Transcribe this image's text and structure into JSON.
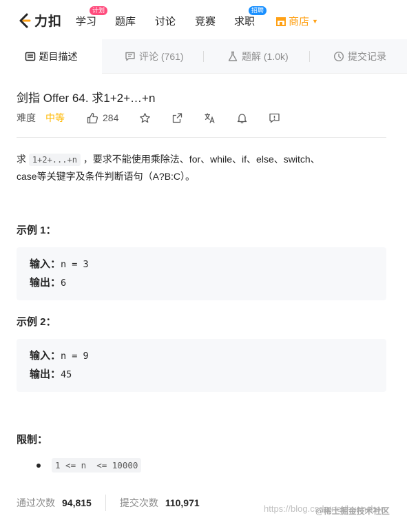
{
  "nav": {
    "logo_text": "力扣",
    "items": [
      {
        "label": "学习",
        "badge": "计划"
      },
      {
        "label": "题库"
      },
      {
        "label": "讨论"
      },
      {
        "label": "竞赛"
      },
      {
        "label": "求职",
        "badge": "招聘"
      },
      {
        "label": "商店"
      }
    ]
  },
  "tabs": [
    {
      "label": "题目描述",
      "icon": "description-icon",
      "active": true
    },
    {
      "label": "评论 (761)",
      "icon": "comment-icon"
    },
    {
      "label": "题解 (1.0k)",
      "icon": "flask-icon"
    },
    {
      "label": "提交记录",
      "icon": "history-icon"
    }
  ],
  "problem": {
    "title": "剑指 Offer 64. 求1+2+…+n",
    "difficulty_label": "难度",
    "difficulty": "中等",
    "likes": "284",
    "desc_prefix": "求 ",
    "desc_code": "1+2+...+n",
    "desc_line1_rest": " ，要求不能使用乘除法、for、while、if、else、switch、",
    "desc_line2": "case等关键字及条件判断语句（A?B:C）。",
    "examples": [
      {
        "title": "示例 1：",
        "input_label": "输入：",
        "input": "n = 3",
        "output_label": "输出：",
        "output": "6"
      },
      {
        "title": "示例 2：",
        "input_label": "输入：",
        "input": "n = 9",
        "output_label": "输出：",
        "output": "45"
      }
    ],
    "limit_title": "限制：",
    "limit": "1 <= n  <= 10000"
  },
  "stats": {
    "passed_label": "通过次数",
    "passed": "94,815",
    "submitted_label": "提交次数",
    "submitted": "110,971"
  },
  "watermark": "https://blog.csdn.net/huanchen",
  "watermark_overlay": "@稀土掘金技术社区",
  "colors": {
    "accent": "#ffa116",
    "medium": "#ffb800",
    "badge_pink": "#ff4d7e",
    "badge_blue": "#1a90ff"
  }
}
